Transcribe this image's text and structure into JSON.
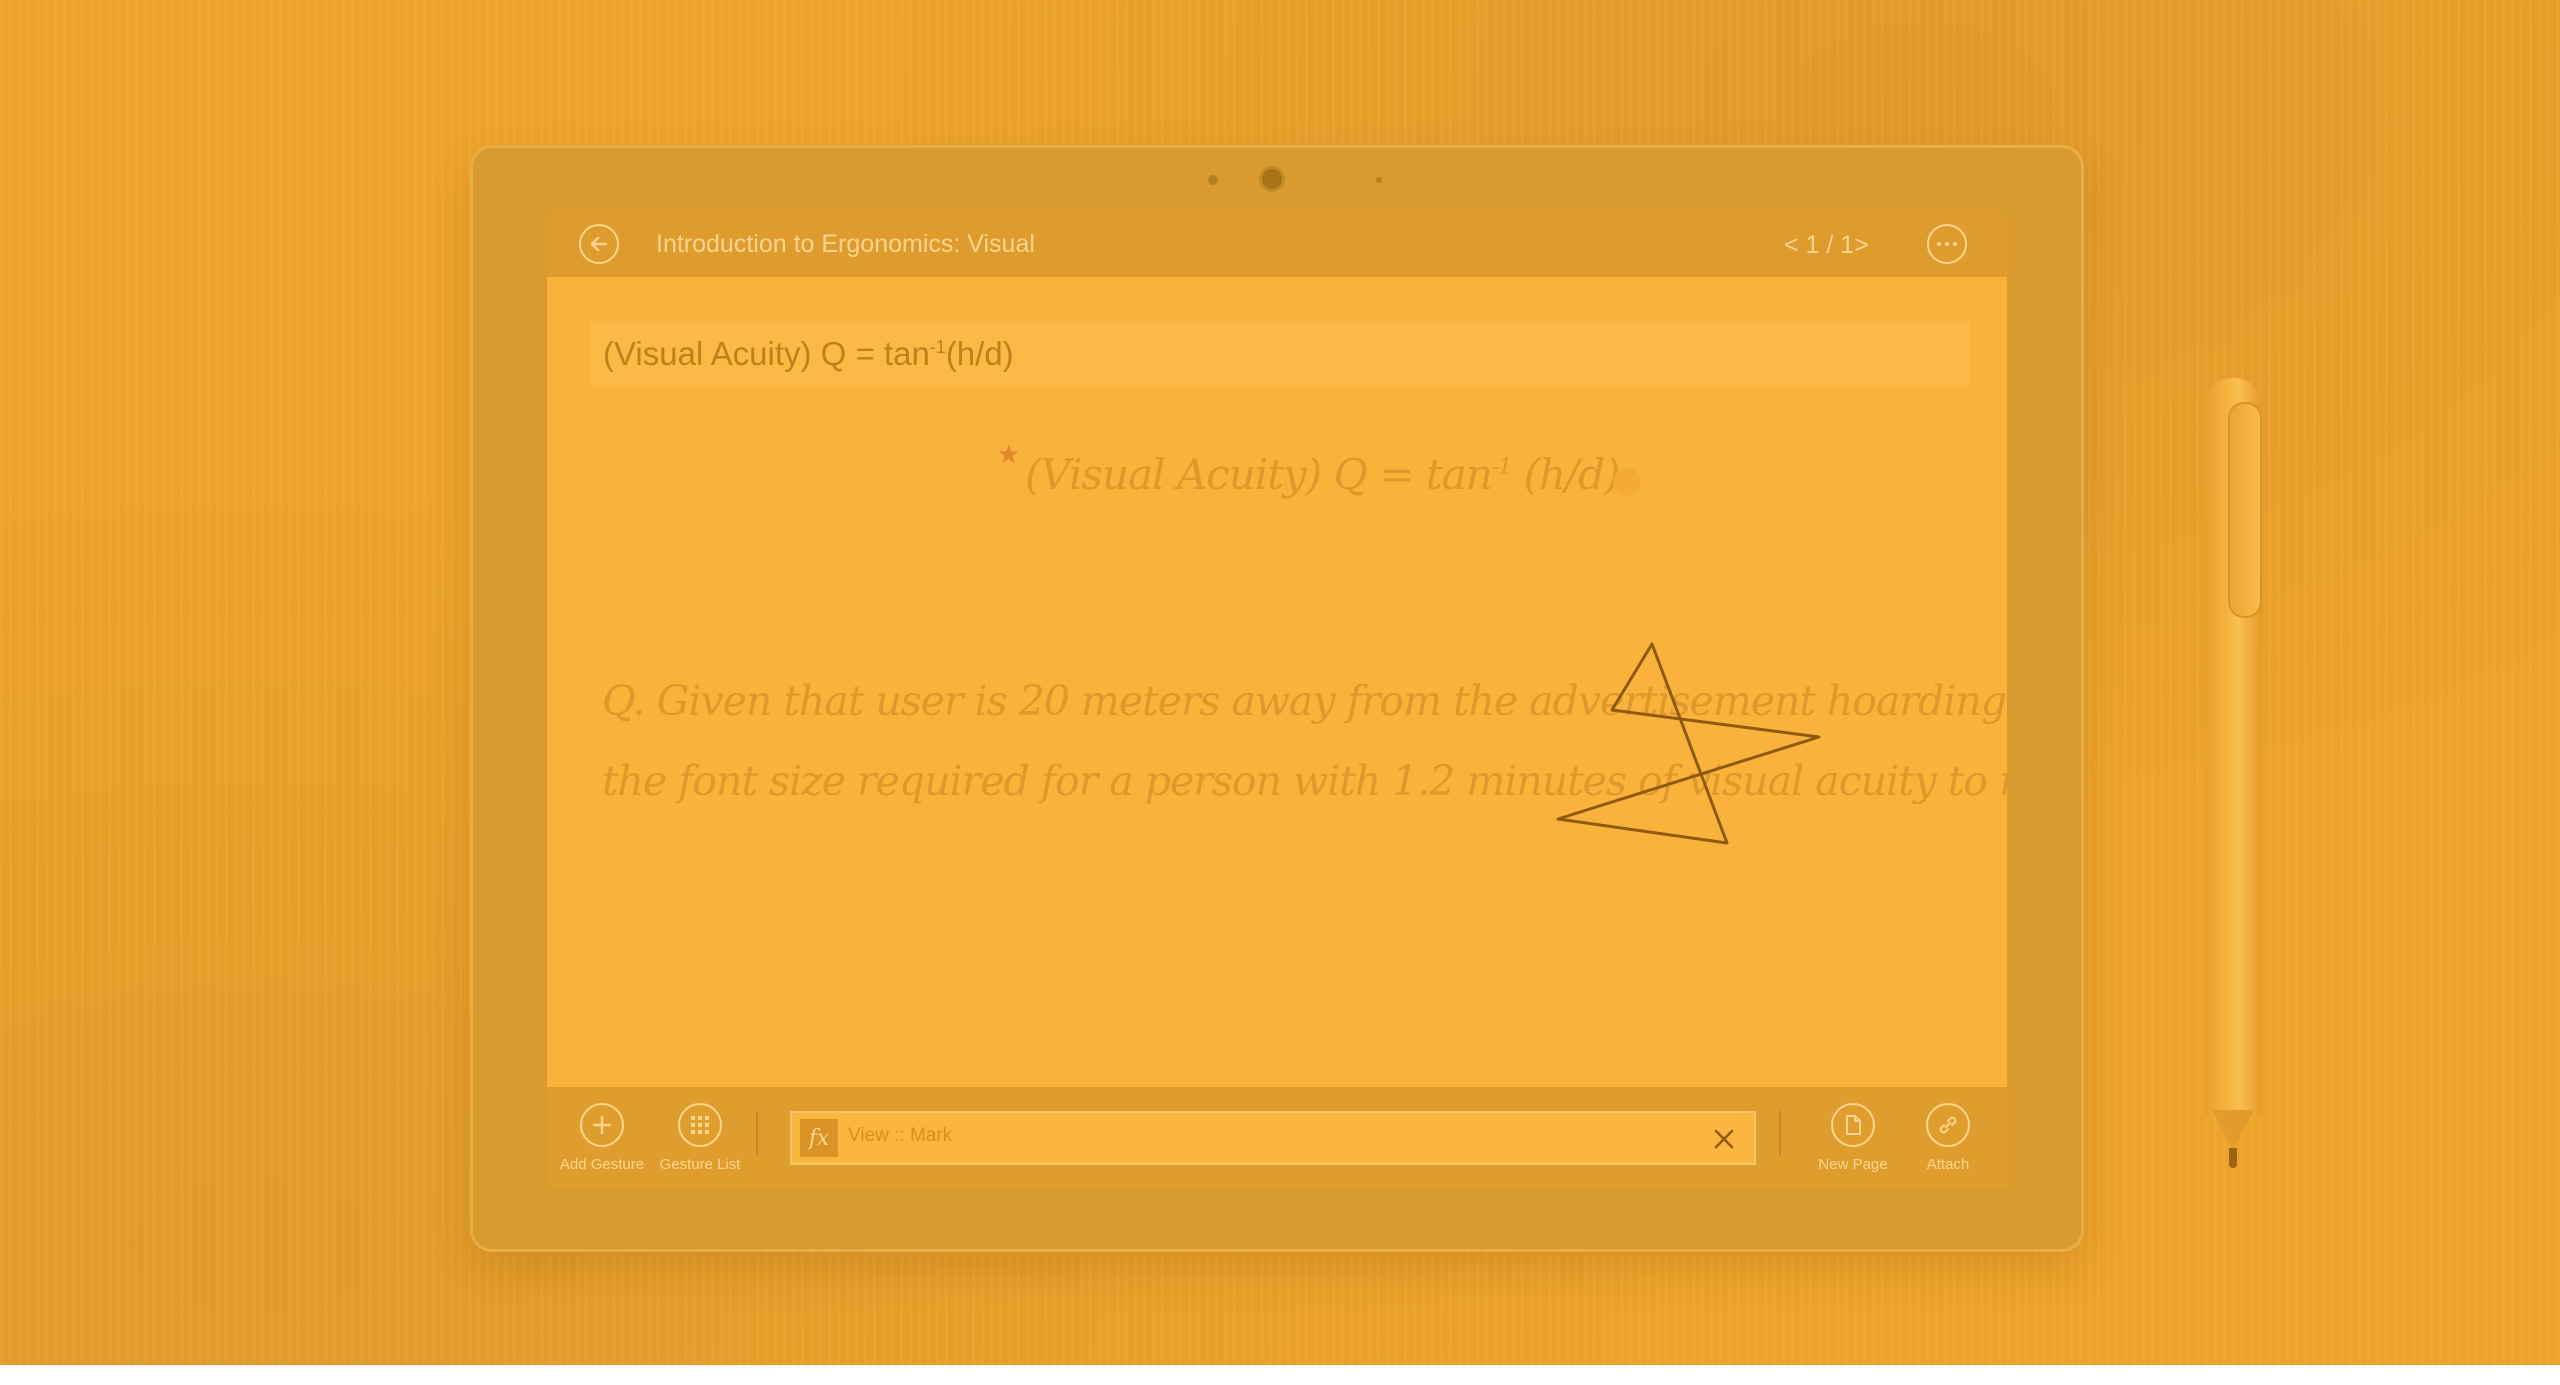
{
  "app": {
    "title": "Introduction to Ergonomics: Visual",
    "pager": "< 1 / 1>"
  },
  "toolbar": {
    "back_icon": "back-arrow-icon",
    "more_icon": "more-ellipsis-icon"
  },
  "document": {
    "formula_typed": {
      "main": "(Visual Acuity) Q = tan",
      "sup": "-1",
      "tail": "(h/d)"
    },
    "handwritten_formula": {
      "main": "(Visual Acuity) Q = tan",
      "sup": "-1",
      "tail": " (h/d)"
    },
    "question_line1": "Q. Given that user is 20 meters away from the advertisement hoarding. Determine",
    "question_line2": "the font size required for a person with 1.2 minutes of visual acuity to read the ad."
  },
  "bottombar": {
    "add_gesture_label": "Add Gesture",
    "gesture_list_label": "Gesture List",
    "command_text": "View :: Mark",
    "new_page_label": "New Page",
    "attach_label": "Attach"
  },
  "colors": {
    "overlay": "#F0A52C",
    "screen_bg": "#FAB33A",
    "bar_bg": "#DF9B2D",
    "ink": "#8F5A10"
  }
}
